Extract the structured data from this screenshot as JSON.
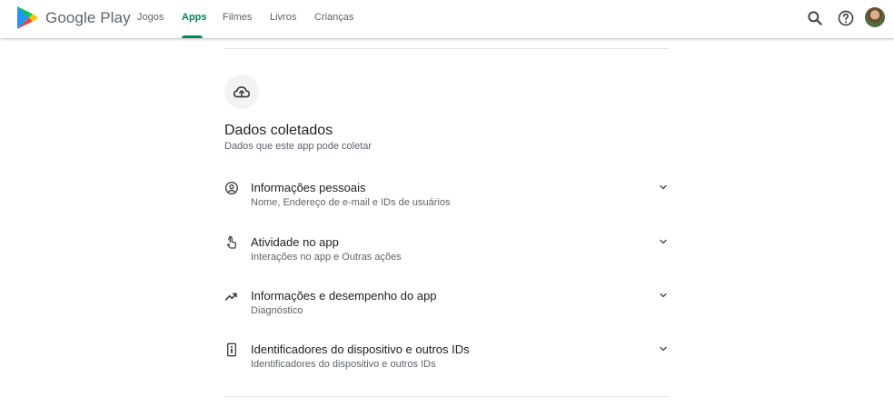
{
  "header": {
    "brand": "Google Play",
    "nav": [
      "Jogos",
      "Apps",
      "Filmes",
      "Livros",
      "Crianças"
    ],
    "active_nav": "Apps",
    "icons": [
      "search-icon",
      "help-icon",
      "avatar"
    ],
    "accent_color": "#01875f"
  },
  "section": {
    "icon": "cloud-upload-icon",
    "title": "Dados coletados",
    "subtitle": "Dados que este app pode coletar"
  },
  "items": [
    {
      "icon": "account-circle-icon",
      "title": "Informações pessoais",
      "subtitle": "Nome, Endereço de e-mail e IDs de usuários"
    },
    {
      "icon": "touch-icon",
      "title": "Atividade no app",
      "subtitle": "Interações no app e Outras ações"
    },
    {
      "icon": "trending-icon",
      "title": "Informações e desempenho do app",
      "subtitle": "Diagnóstico"
    },
    {
      "icon": "device-id-icon",
      "title": "Identificadores do dispositivo e outros IDs",
      "subtitle": "Identificadores do dispositivo e outros IDs"
    }
  ]
}
